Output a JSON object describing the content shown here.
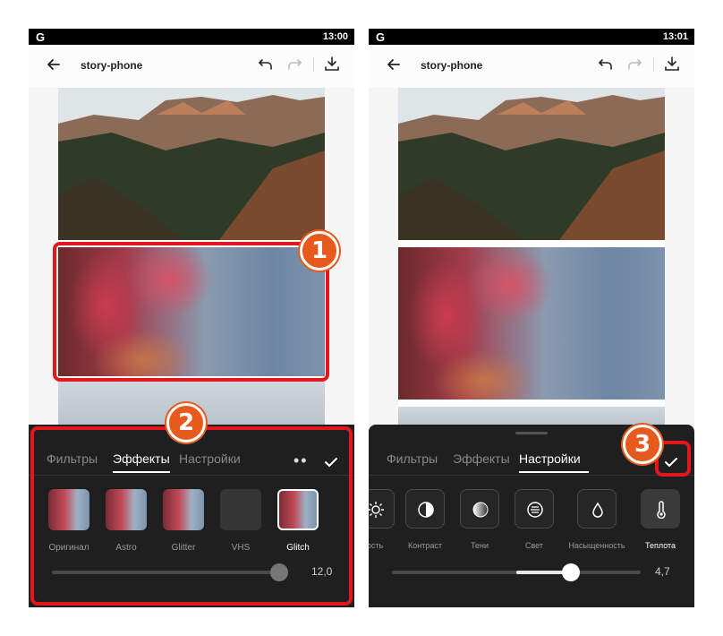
{
  "left": {
    "status": {
      "logo": "G",
      "time": "13:00"
    },
    "topbar": {
      "title": "story-phone"
    },
    "tabs": [
      "Фильтры",
      "Эффекты",
      "Настройки"
    ],
    "active_tab": "Эффекты",
    "effects": [
      {
        "label": "Оригинал"
      },
      {
        "label": "Astro"
      },
      {
        "label": "Glitter"
      },
      {
        "label": "VHS"
      },
      {
        "label": "Glitch"
      }
    ],
    "selected_effect": "Glitch",
    "slider": {
      "value_text": "12,0",
      "fraction": 1.0
    },
    "badges": [
      "1",
      "2"
    ]
  },
  "right": {
    "status": {
      "logo": "G",
      "time": "13:01"
    },
    "topbar": {
      "title": "story-phone"
    },
    "tabs": [
      "Фильтры",
      "Эффекты",
      "Настройки"
    ],
    "active_tab": "Настройки",
    "tools": [
      {
        "label": "ость",
        "icon": "brightness-icon"
      },
      {
        "label": "Контраст",
        "icon": "contrast-icon"
      },
      {
        "label": "Тени",
        "icon": "shadows-icon"
      },
      {
        "label": "Свет",
        "icon": "light-icon"
      },
      {
        "label": "Насыщенность",
        "icon": "saturation-icon"
      },
      {
        "label": "Теплота",
        "icon": "thermometer-icon"
      }
    ],
    "active_tool": "Теплота",
    "slider": {
      "value_text": "4,7",
      "fraction": 0.72
    },
    "badges": [
      "3"
    ]
  },
  "colors": {
    "highlight": "#e2161b",
    "badge": "#e65a1e",
    "panel": "#1f1f1f"
  }
}
